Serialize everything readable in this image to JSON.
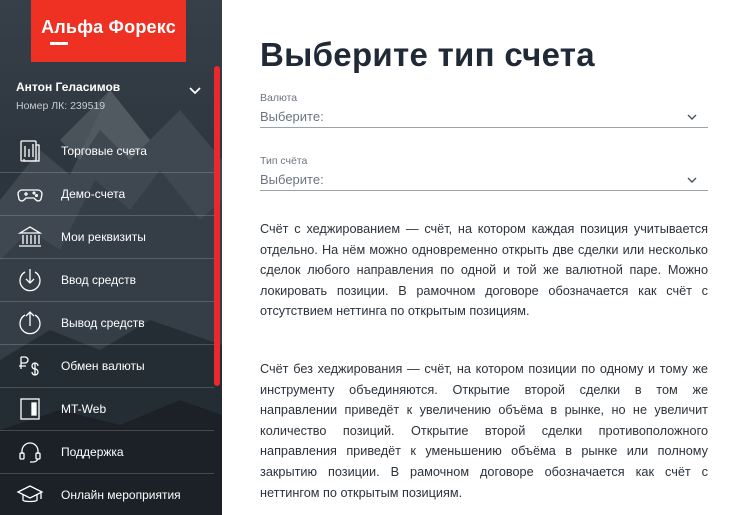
{
  "brand": {
    "name": "Альфа Форекс",
    "color": "#ef3124"
  },
  "user": {
    "name": "Антон Геласимов",
    "id_text": "Номер ЛК: 239519"
  },
  "menu": [
    {
      "label": "Торговые счета",
      "icon": "trading-accounts-icon"
    },
    {
      "label": "Демо-счета",
      "icon": "gamepad-icon"
    },
    {
      "label": "Мои реквизиты",
      "icon": "bank-icon"
    },
    {
      "label": "Ввод средств",
      "icon": "deposit-arrow-icon"
    },
    {
      "label": "Вывод средств",
      "icon": "withdraw-arrow-icon"
    },
    {
      "label": "Обмен валюты",
      "icon": "currency-exchange-icon"
    },
    {
      "label": "MT-Web",
      "icon": "mt-web-icon"
    },
    {
      "label": "Поддержка",
      "icon": "headset-icon"
    },
    {
      "label": "Онлайн мероприятия",
      "icon": "graduation-cap-icon"
    }
  ],
  "page": {
    "title": "Выберите тип счета"
  },
  "form": {
    "currency": {
      "label": "Валюта",
      "value": "Выберите:"
    },
    "account_type": {
      "label": "Тип счёта",
      "value": "Выберите:"
    }
  },
  "descriptions": {
    "hedging": "Счёт с хеджированием — счёт, на котором каждая позиция учитывается отдельно. На нём можно одновременно открыть две сделки или несколько сделок любого направления по одной и той же валютной паре. Можно локировать позиции. В рамочном договоре обозначается как счёт с отсутствием неттинга по открытым позициям.",
    "netting": "Счёт без хеджирования — счёт, на котором позиции по одному и тому же инструменту объединяются. Открытие второй сделки в том же направлении приведёт к увеличению объёма в рынке, но не увеличит количество позиций. Открытие второй сделки противоположного направления приведёт к уменьшению объёма в рынке или полному закрытию позиции. В рамочном договоре обозначается как счёт с неттингом по открытым позициям."
  }
}
